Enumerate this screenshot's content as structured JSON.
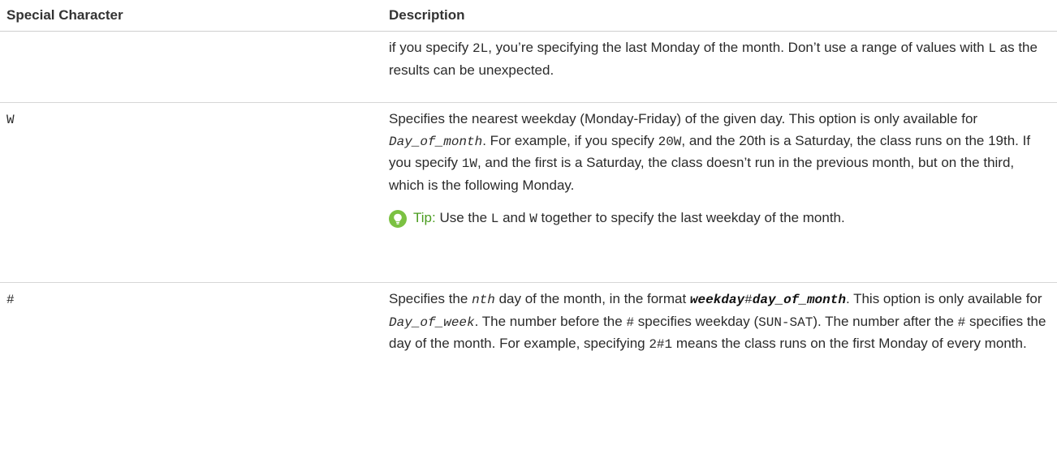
{
  "table": {
    "headers": [
      "Special Character",
      "Description"
    ],
    "rows": [
      {
        "character": "",
        "desc": {
          "t1": "if you specify ",
          "c1": "2L",
          "t2": ", you’re specifying the last Monday of the month. Don’t use a range of values with ",
          "c2": "L",
          "t3": " as the results can be unexpected."
        }
      },
      {
        "character": "W",
        "desc": {
          "t1": "Specifies the nearest weekday (Monday-Friday) of the given day. This option is only available for ",
          "i1": "Day_of_month",
          "t2": ". For example, if you specify ",
          "c1": "20W",
          "t3": ", and the 20th is a Saturday, the class runs on the 19th. If you specify ",
          "c2": "1W",
          "t4": ", and the first is a Saturday, the class doesn’t run in the previous month, but on the third, which is the following Monday."
        },
        "tip": {
          "label": "Tip:",
          "t1": " Use the ",
          "c1": "L",
          "t2": " and ",
          "c2": "W",
          "t3": " together to specify the last weekday of the month."
        }
      },
      {
        "character": "#",
        "desc": {
          "t1": "Specifies the ",
          "i1": "nth",
          "t2": " day of the month, in the format ",
          "b1": "weekday",
          "c0": "#",
          "b2": "day_of_month",
          "t3": ". This option is only available for ",
          "i2": "Day_of_week",
          "t4": ". The number before the ",
          "c1": "#",
          "t5": " specifies weekday (",
          "c2": "SUN-SAT",
          "t6": "). The number after the ",
          "c3": "#",
          "t7": " specifies the day of the month. For example, specifying ",
          "c4": "2#1",
          "t8": " means the class runs on the first Monday of every month."
        }
      }
    ]
  }
}
